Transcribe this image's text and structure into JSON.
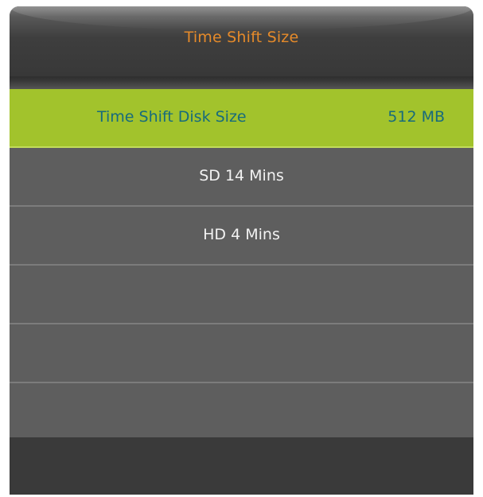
{
  "menu": {
    "title": "Time Shift Size",
    "rows": [
      {
        "label": "Time Shift Disk Size",
        "value": "512 MB",
        "selected": true
      },
      {
        "label": "SD 14 Mins",
        "value": ""
      },
      {
        "label": "HD 4 Mins",
        "value": ""
      },
      {
        "label": "",
        "value": ""
      },
      {
        "label": "",
        "value": ""
      },
      {
        "label": "",
        "value": ""
      }
    ]
  },
  "colors": {
    "title": "#e58a2a",
    "selected_row": "#a2c32c",
    "selected_text": "#176b7c",
    "row": "#5e5e5e",
    "panel": "#3c3c3c"
  }
}
